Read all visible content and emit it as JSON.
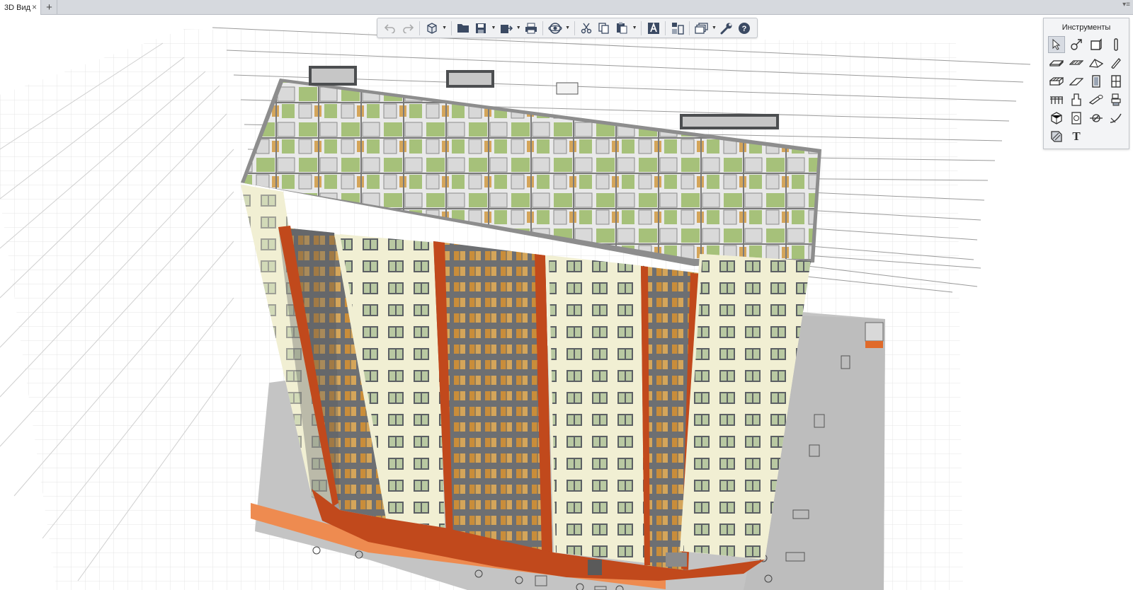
{
  "tabbar": {
    "active_tab": "3D Вид",
    "close_glyph": "×",
    "add_glyph": "+",
    "menu_glyph": "▾≡"
  },
  "toolbar": {
    "buttons": [
      {
        "icon": "undo-icon",
        "enabled": false
      },
      {
        "icon": "redo-icon",
        "enabled": false
      },
      {
        "icon": "3d-cube-icon",
        "dropdown": true
      },
      {
        "icon": "folder-open-icon"
      },
      {
        "icon": "save-icon",
        "dropdown": true
      },
      {
        "icon": "export-icon",
        "dropdown": true
      },
      {
        "icon": "print-icon"
      },
      {
        "icon": "orbit-icon",
        "dropdown": true
      },
      {
        "icon": "cut-icon"
      },
      {
        "icon": "copy-icon"
      },
      {
        "icon": "paste-icon",
        "dropdown": true
      },
      {
        "icon": "text-style-icon"
      },
      {
        "icon": "layout-icon"
      },
      {
        "icon": "layers-icon",
        "dropdown": true
      },
      {
        "icon": "settings-wrench-icon"
      },
      {
        "icon": "help-icon"
      }
    ]
  },
  "tools_panel": {
    "title": "Инструменты",
    "text_tool_glyph": "T",
    "tools": [
      "select-arrow-icon",
      "transform-icon",
      "wall-icon",
      "column-icon",
      "slab-icon",
      "floor-icon",
      "roof-icon",
      "beam-icon",
      "stair-icon",
      "ramp-icon",
      "door-icon",
      "window-icon",
      "railing-icon",
      "object-icon",
      "pipe-icon",
      "equipment-icon",
      "room-icon",
      "annotation-icon",
      "section-icon",
      "dimension-icon",
      "hatch-icon",
      "text-icon"
    ]
  },
  "colors": {
    "facade": "#f1efd3",
    "accent_orange": "#c1491c",
    "balcony_frame": "#76787a",
    "balcony_fill": "#d4a55a",
    "floor_green": "#a6c17a",
    "podium_gray": "#bebebe",
    "grid_line": "#e4e4e4"
  }
}
